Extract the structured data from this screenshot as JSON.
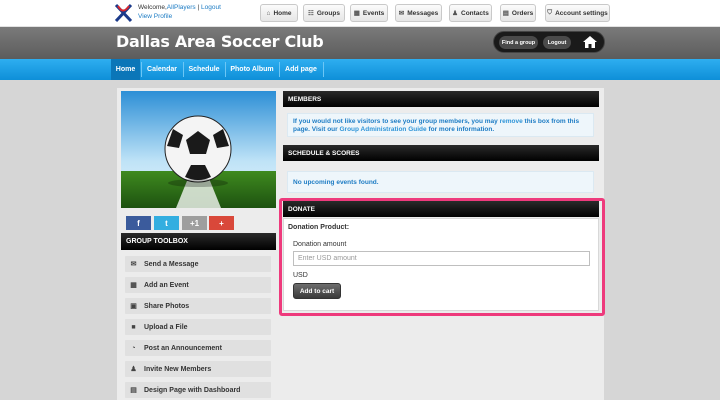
{
  "topbar": {
    "welcome_prefix": "Welcome,",
    "username": "AllPlayers",
    "separator": "|",
    "logout": "Logout",
    "view_profile": "View Profile",
    "buttons": [
      {
        "label": "Home",
        "icon": "home-icon"
      },
      {
        "label": "Groups",
        "icon": "groups-icon"
      },
      {
        "label": "Events",
        "icon": "calendar-icon"
      },
      {
        "label": "Messages",
        "icon": "envelope-icon"
      },
      {
        "label": "Contacts",
        "icon": "person-icon"
      },
      {
        "label": "Orders",
        "icon": "cart-icon"
      },
      {
        "label": "Account settings",
        "icon": "shield-icon"
      }
    ]
  },
  "header": {
    "title": "Dallas Area Soccer Club",
    "find_group": "Find a group",
    "logout": "Logout"
  },
  "nav": {
    "items": [
      {
        "label": "Home",
        "active": true
      },
      {
        "label": "Calendar",
        "active": false
      },
      {
        "label": "Schedule",
        "active": false
      },
      {
        "label": "Photo Album",
        "active": false
      },
      {
        "label": "Add page",
        "active": false
      }
    ]
  },
  "social": {
    "facebook": "f",
    "twitter": "t",
    "googleplus": "+1",
    "plus": "+"
  },
  "toolbox": {
    "title": "GROUP TOOLBOX",
    "items": [
      {
        "label": "Send a Message",
        "icon": "envelope-icon"
      },
      {
        "label": "Add an Event",
        "icon": "calendar-icon"
      },
      {
        "label": "Share Photos",
        "icon": "photo-icon"
      },
      {
        "label": "Upload a File",
        "icon": "folder-icon"
      },
      {
        "label": "Post an Announcement",
        "icon": "rss-icon"
      },
      {
        "label": "Invite New Members",
        "icon": "user-icon"
      },
      {
        "label": "Design Page with Dashboard",
        "icon": "dashboard-icon"
      }
    ]
  },
  "members": {
    "title": "MEMBERS",
    "text1": "If you would not like visitors to see your group members, you may ",
    "link_remove": "remove",
    "text2": " this box from this page. Visit our ",
    "link_guide": "Group Administration Guide",
    "text3": " for more information."
  },
  "schedule": {
    "title": "SCHEDULE & SCORES",
    "empty": "No upcoming events found."
  },
  "donate": {
    "title": "DONATE",
    "product_label": "Donation Product:",
    "amount_label": "Donation amount",
    "amount_placeholder": "Enter USD amount",
    "currency": "USD",
    "button": "Add to cart",
    "highlight_color": "#ee3a7c"
  }
}
